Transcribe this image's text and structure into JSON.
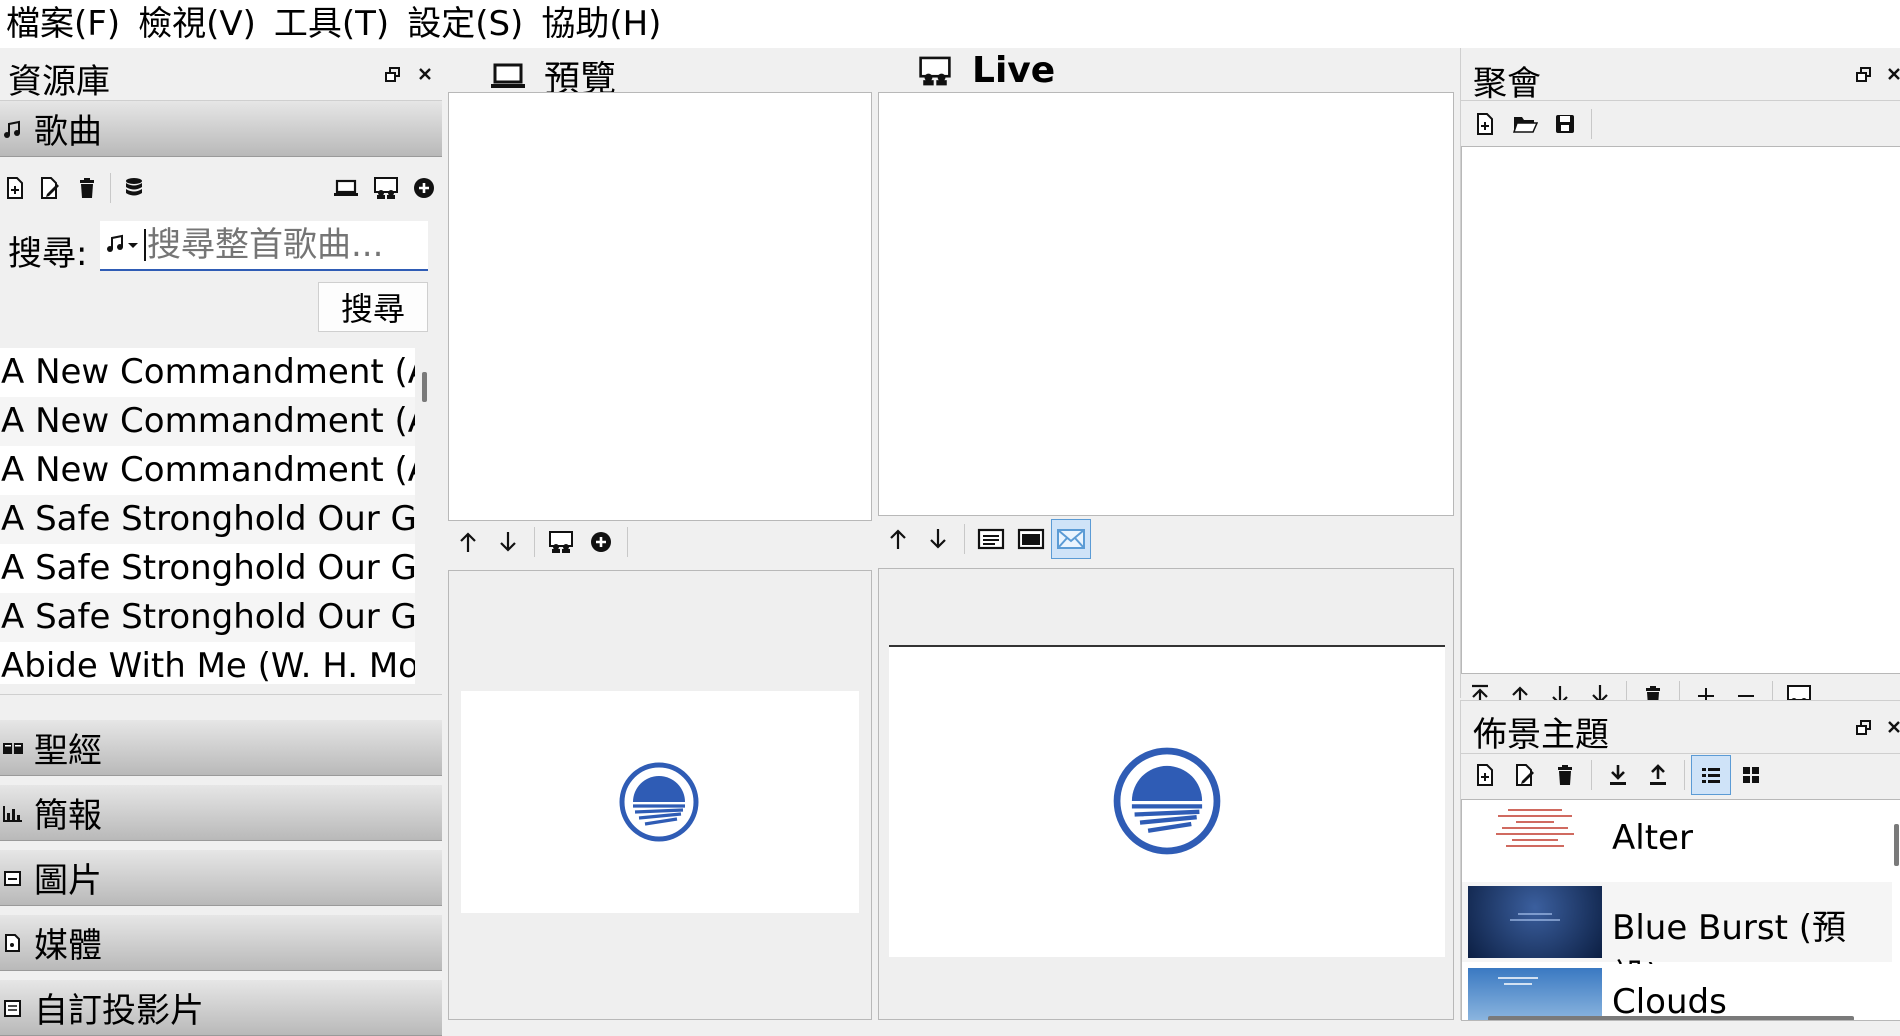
{
  "menu": [
    "檔案(F)",
    "檢視(V)",
    "工具(T)",
    "設定(S)",
    "協助(H)"
  ],
  "library": {
    "title": "資源庫",
    "float_icon": "float-icon",
    "close_icon": "close-icon",
    "songs_category": "歌曲",
    "search_label": "搜尋:",
    "search_placeholder": "搜尋整首歌曲...",
    "search_button": "搜尋",
    "songs": [
      "A New Commandment (Au",
      "A New Commandment (Au",
      "A New Commandment (Au",
      "A Safe Stronghold Our Goo",
      "A Safe Stronghold Our Goo",
      "A Safe Stronghold Our Goo",
      "Abide With Me (W. H. Mor"
    ],
    "categories": [
      "聖經",
      "簡報",
      "圖片",
      "媒體",
      "自訂投影片"
    ]
  },
  "preview": {
    "title": "預覽"
  },
  "live": {
    "title": "Live"
  },
  "service": {
    "title": "聚會"
  },
  "themes": {
    "title": "佈景主題",
    "items": [
      "Alter",
      "Blue Burst (預設)",
      "Clouds"
    ]
  },
  "colors": {
    "accent_blue": "#2f5cb5",
    "active_tool": "#cfe3f8",
    "category_bar": "#c8c8c8"
  }
}
